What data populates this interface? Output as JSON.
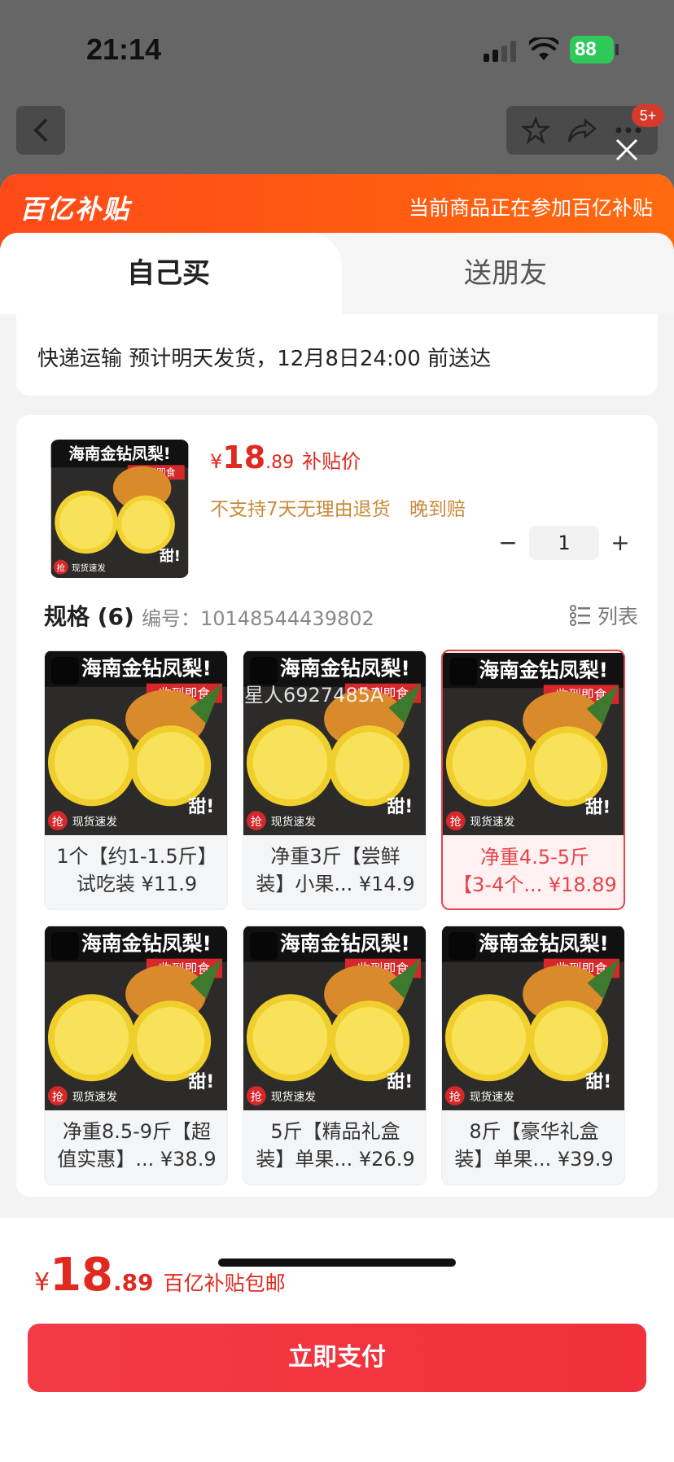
{
  "status_bar": {
    "time": "21:14",
    "battery": "88"
  },
  "header": {
    "badge": "5+"
  },
  "banner": {
    "logo": "百亿补贴",
    "message": "当前商品正在参加百亿补贴"
  },
  "tabs": [
    {
      "label": "自己买"
    },
    {
      "label": "送朋友"
    }
  ],
  "shipping": {
    "text": "快递运输 预计明天发货，12月8日24:00 前送达"
  },
  "product": {
    "thumb_text": {
      "title": "海南金钻凤梨!",
      "sub": "收到即食",
      "sweet": "甜!",
      "tag": "现货速发",
      "grab": "抢"
    },
    "price_yen": "¥",
    "price_int": "18",
    "price_dec": ".89",
    "price_tag": "补贴价",
    "policies": [
      "不支持7天无理由退货",
      "晚到赔"
    ],
    "quantity": "1",
    "minus": "−",
    "plus": "+"
  },
  "specs": {
    "title": "规格 (6)",
    "code": "编号：10148544439802",
    "list_label": "列表",
    "watermark": "星人6927485A",
    "items": [
      {
        "line1": "1个【约1-1.5斤】",
        "line2": "试吃装 ¥11.9"
      },
      {
        "line1": "净重3斤【尝鲜",
        "line2": "装】小果... ¥14.9"
      },
      {
        "line1": "净重4.5-5斤",
        "line2": "【3-4个... ¥18.89"
      },
      {
        "line1": "净重8.5-9斤【超",
        "line2": "值实惠】... ¥38.9"
      },
      {
        "line1": "5斤【精品礼盒",
        "line2": "装】单果... ¥26.9"
      },
      {
        "line1": "8斤【豪华礼盒",
        "line2": "装】单果... ¥39.9"
      }
    ],
    "selected_index": 2
  },
  "footer": {
    "yen": "¥",
    "total_int": "18",
    "total_dec": ".89",
    "note": "百亿补贴包邮",
    "pay_label": "立即支付"
  },
  "colors": {
    "accent": "#e0291f",
    "banner": "#ff5a12",
    "pay": "#f23b45"
  }
}
